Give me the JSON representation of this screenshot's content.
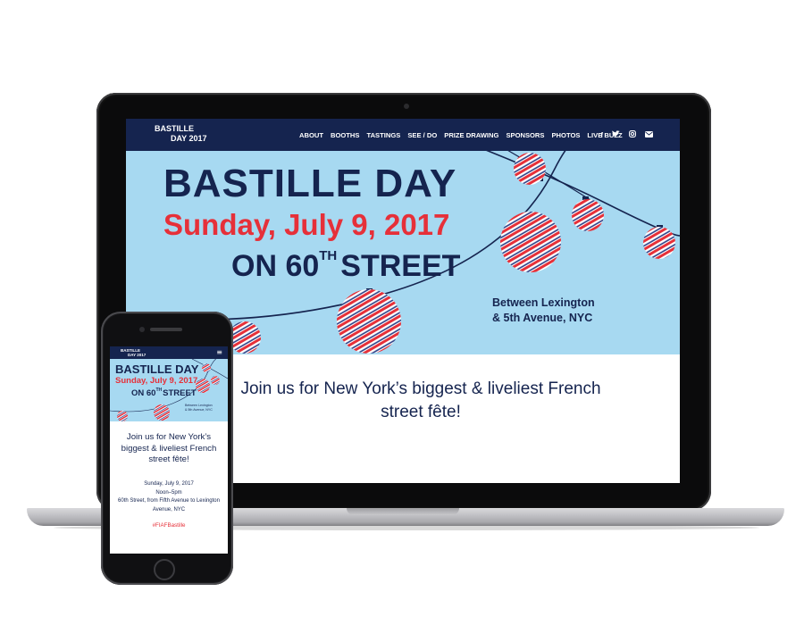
{
  "colors": {
    "navy": "#15244f",
    "red": "#e63039",
    "sky": "#a7d9f1",
    "white": "#ffffff"
  },
  "laptop": {
    "nav": {
      "logo_line1": "BASTILLE",
      "logo_line2": "DAY 2017",
      "links": [
        "ABOUT",
        "BOOTHS",
        "TASTINGS",
        "SEE / DO",
        "PRIZE DRAWING",
        "SPONSORS",
        "PHOTOS",
        "LIVE BUZZ"
      ],
      "icons": [
        "facebook-icon",
        "twitter-icon",
        "instagram-icon",
        "email-icon"
      ]
    },
    "hero": {
      "title": "BASTILLE  DAY",
      "date": "Sunday, July 9, 2017",
      "street_prefix": "ON 60",
      "street_sup": "TH",
      "street_suffix": "STREET",
      "location_line1": "Between Lexington",
      "location_line2": "& 5th Avenue, NYC"
    },
    "tagline_line1": "Join us for New York’s biggest & liveliest French",
    "tagline_line2": "street fête!"
  },
  "phone": {
    "nav": {
      "logo_line1": "BASTILLE",
      "logo_line2": "DAY 2017",
      "menu_icon": "hamburger-menu-icon"
    },
    "hero": {
      "title": "BASTILLE DAY",
      "date": "Sunday, July 9, 2017",
      "street_prefix": "ON 60",
      "street_sup": "TH",
      "street_suffix": "STREET",
      "location_line1": "Between Lexington",
      "location_line2": "& 5th Avenue, NYC"
    },
    "tagline_line1": "Join us for New York’s",
    "tagline_line2": "biggest & liveliest French",
    "tagline_line3": "street fête!",
    "info_line1": "Sunday, July 9, 2017",
    "info_line2": "Noon–5pm",
    "info_line3": "60th Street, from Fifth Avenue to Lexington",
    "info_line4": "Avenue, NYC",
    "hashtag": "#FIAFBastille"
  }
}
